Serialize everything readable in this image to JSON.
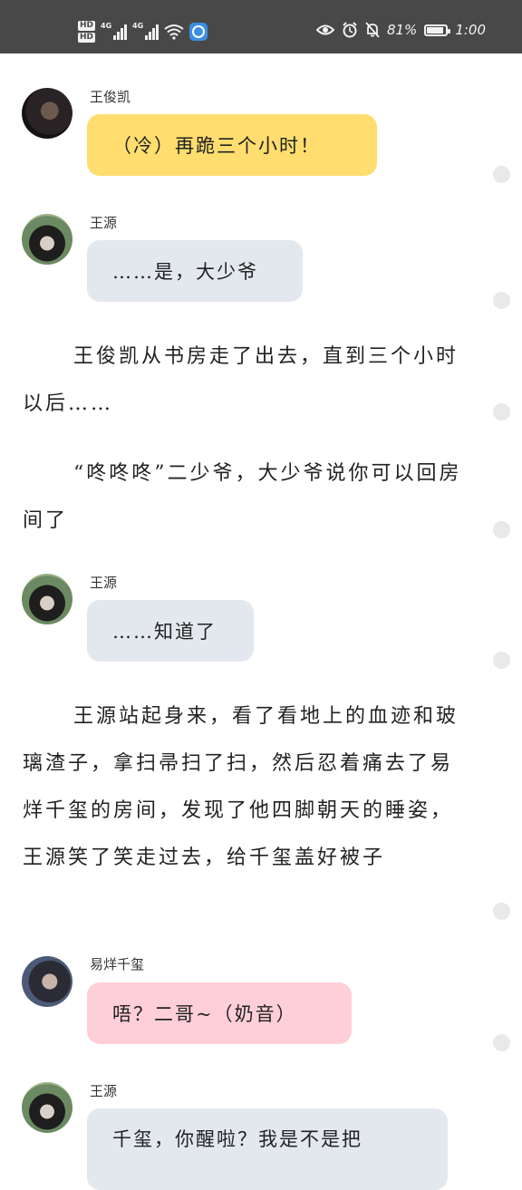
{
  "status_bar": {
    "hd_top": "HD",
    "hd_bottom": "HD",
    "net1": "4G",
    "net2": "4G",
    "battery_text": "81%",
    "battery_level": 0.81,
    "time": "1:00"
  },
  "messages": [
    {
      "type": "bubble",
      "speaker": "王俊凯",
      "text": "（冷）再跪三个小时！",
      "color": "#ffdd6e"
    },
    {
      "type": "bubble",
      "speaker": "王源",
      "text": "……是，大少爷",
      "color": "#e3e8ef"
    },
    {
      "type": "narration",
      "text": "王俊凯从书房走了出去，直到三个小时以后……"
    },
    {
      "type": "narration",
      "text": "“咚咚咚”二少爷，大少爷说你可以回房间了"
    },
    {
      "type": "bubble",
      "speaker": "王源",
      "text": "……知道了",
      "color": "#e3e8ef"
    },
    {
      "type": "narration",
      "text": "王源站起身来，看了看地上的血迹和玻璃渣子，拿扫帚扫了扫，然后忍着痛去了易烊千玺的房间，发现了他四脚朝天的睡姿，王源笑了笑走过去，给千玺盖好被子"
    },
    {
      "type": "bubble",
      "speaker": "易烊千玺",
      "text": "唔？二哥~（奶音）",
      "color": "#ffcfd8"
    },
    {
      "type": "bubble",
      "speaker": "王源",
      "text": "千玺，你醒啦？我是不是把",
      "color": "#e3e8ef"
    }
  ]
}
